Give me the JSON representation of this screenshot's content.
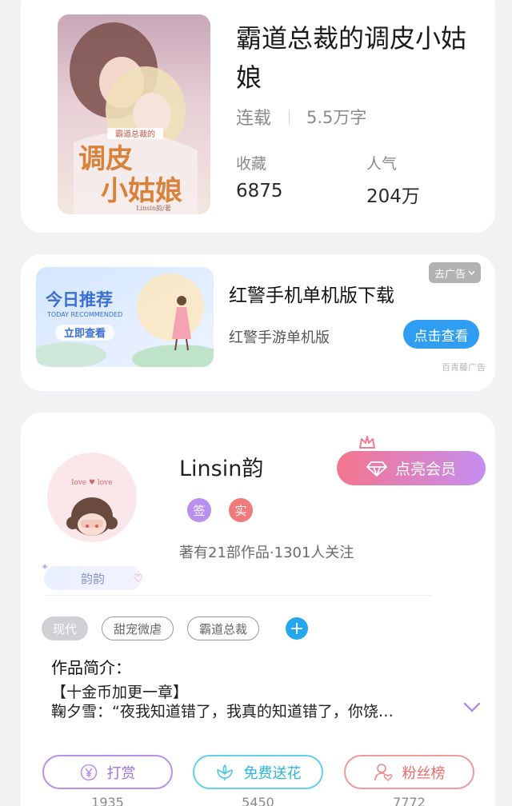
{
  "book": {
    "title": "霸道总裁的调皮小姑娘",
    "cover_text_top": "霸道总裁的",
    "cover_text_main1": "调皮",
    "cover_text_main2": "小姑娘",
    "cover_author": "Linsin韵/著",
    "status": "连载",
    "word_count": "5.5万字",
    "favorites_label": "收藏",
    "favorites_value": "6875",
    "popularity_label": "人气",
    "popularity_value": "204万"
  },
  "ad": {
    "banner_title": "今日推荐",
    "banner_subtitle": "TODAY RECOMMENDED",
    "banner_cta": "立即查看",
    "title": "红警手机单机版下载",
    "subtitle": "红警手游单机版",
    "button": "点击查看",
    "close_label": "去广告",
    "source": "百青藤广告"
  },
  "author": {
    "name": "Linsin韵",
    "avatar_text": "love ♥ love",
    "avatar_tag": "韵韵",
    "badge_sign": "签",
    "badge_real": "实",
    "stats": "著有21部作品·1301人关注",
    "vip_button": "点亮会员",
    "tags": [
      "现代",
      "甜宠微虐",
      "霸道总裁"
    ],
    "tag_add": "+",
    "intro_heading": "作品简介：",
    "intro_line1": "【十金币加更一章】",
    "intro_line2": "鞠夕雪：“夜我知道错了，我真的知道错了，你饶…",
    "actions": {
      "reward_label": "打赏",
      "reward_count": "1935",
      "flower_label": "免费送花",
      "flower_count": "5450",
      "fans_label": "粉丝榜",
      "fans_count": "7772"
    }
  },
  "colors": {
    "accent_blue": "#2f9ef2",
    "vip_gradient_start": "#f4758e",
    "vip_gradient_end": "#c58ef0"
  }
}
